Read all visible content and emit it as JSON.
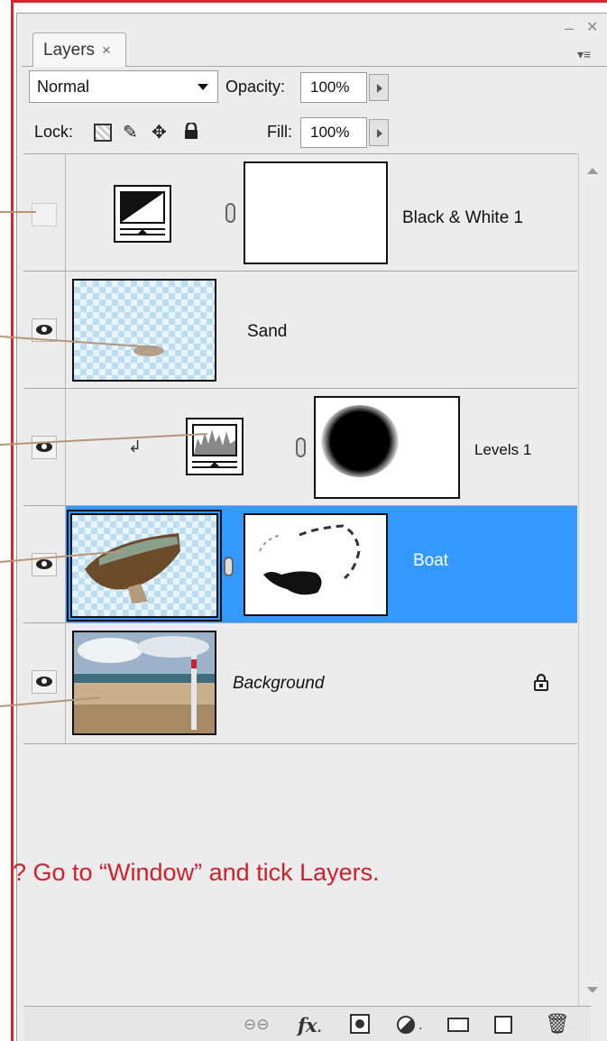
{
  "panel": {
    "tab_label": "Layers",
    "tab_close": "×",
    "minimize": "–",
    "close": "✕",
    "menu_glyph": "▾≡"
  },
  "controls": {
    "blend_mode": "Normal",
    "opacity_label": "Opacity:",
    "opacity_value": "100%",
    "lock_label": "Lock:",
    "fill_label": "Fill:",
    "fill_value": "100%"
  },
  "layers": [
    {
      "name": "Black & White 1",
      "visible": false,
      "type": "adjustment-black-white",
      "has_mask": true
    },
    {
      "name": "Sand",
      "visible": true,
      "type": "pixel"
    },
    {
      "name": "Levels 1",
      "visible": true,
      "type": "adjustment-levels",
      "has_mask": true,
      "clipped": true
    },
    {
      "name": "Boat",
      "visible": true,
      "type": "pixel",
      "has_mask": true,
      "selected": true
    },
    {
      "name": "Background",
      "visible": true,
      "type": "background",
      "locked": true
    }
  ],
  "colors": {
    "selection": "#3399ff",
    "annotation_red": "#d0202c",
    "panel_bg": "#ececec"
  },
  "annotation": {
    "note": "? Go to “Window” and tick Layers."
  },
  "icons": {
    "bottom_bar": [
      "link-icon",
      "fx-icon",
      "add-mask-icon",
      "new-adjustment-icon",
      "new-group-icon",
      "new-layer-icon",
      "trash-icon"
    ]
  }
}
